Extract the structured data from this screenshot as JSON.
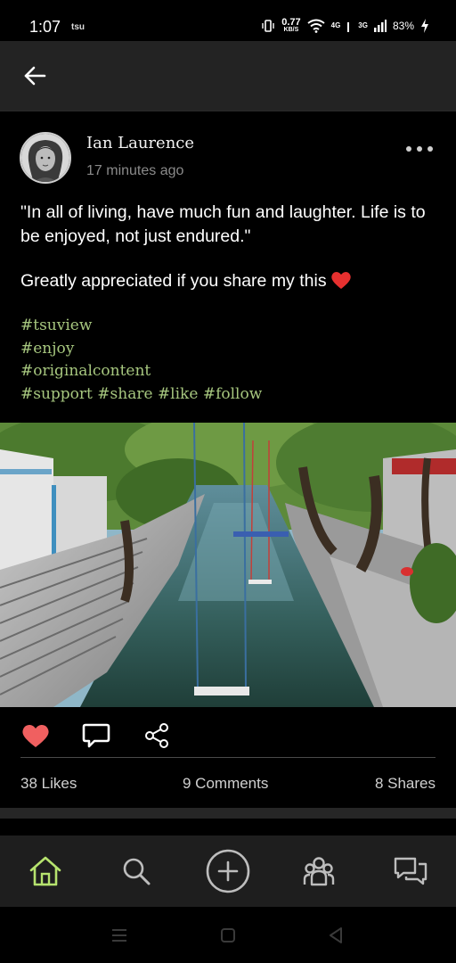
{
  "status_bar": {
    "time": "1:07",
    "app_label": "tsu",
    "net_speed_value": "0.77",
    "net_speed_unit": "KB/S",
    "network_4g": "4G",
    "network_3g": "3G",
    "battery": "83%"
  },
  "post": {
    "author": "Ian Laurence",
    "time_ago": "17 minutes ago",
    "quote": "\"In all of living, have much fun and laughter. Life is to be enjoyed, not just endured.\"",
    "appeal": "Greatly appreciated if you share my this",
    "hashtags": [
      "#tsuview",
      "#enjoy",
      "#originalcontent"
    ],
    "hashtags_last_line": [
      "#support",
      "#share",
      "#like",
      "#follow"
    ],
    "likes": "38 Likes",
    "comments": "9 Comments",
    "shares": "8 Shares"
  },
  "icons": {
    "back": "arrow-left",
    "more": "ellipsis-horizontal",
    "like": "heart-filled",
    "comment": "speech-bubble",
    "share": "share-nodes",
    "home": "house",
    "search": "magnifier",
    "create": "plus-circle",
    "groups": "people",
    "messages": "chat-bubbles"
  },
  "colors": {
    "accent_green": "#a7c77f",
    "home_active": "#b6e36e",
    "like_red": "#f06060",
    "header_bg": "#232323",
    "nav_bg": "#1e1e1e"
  }
}
